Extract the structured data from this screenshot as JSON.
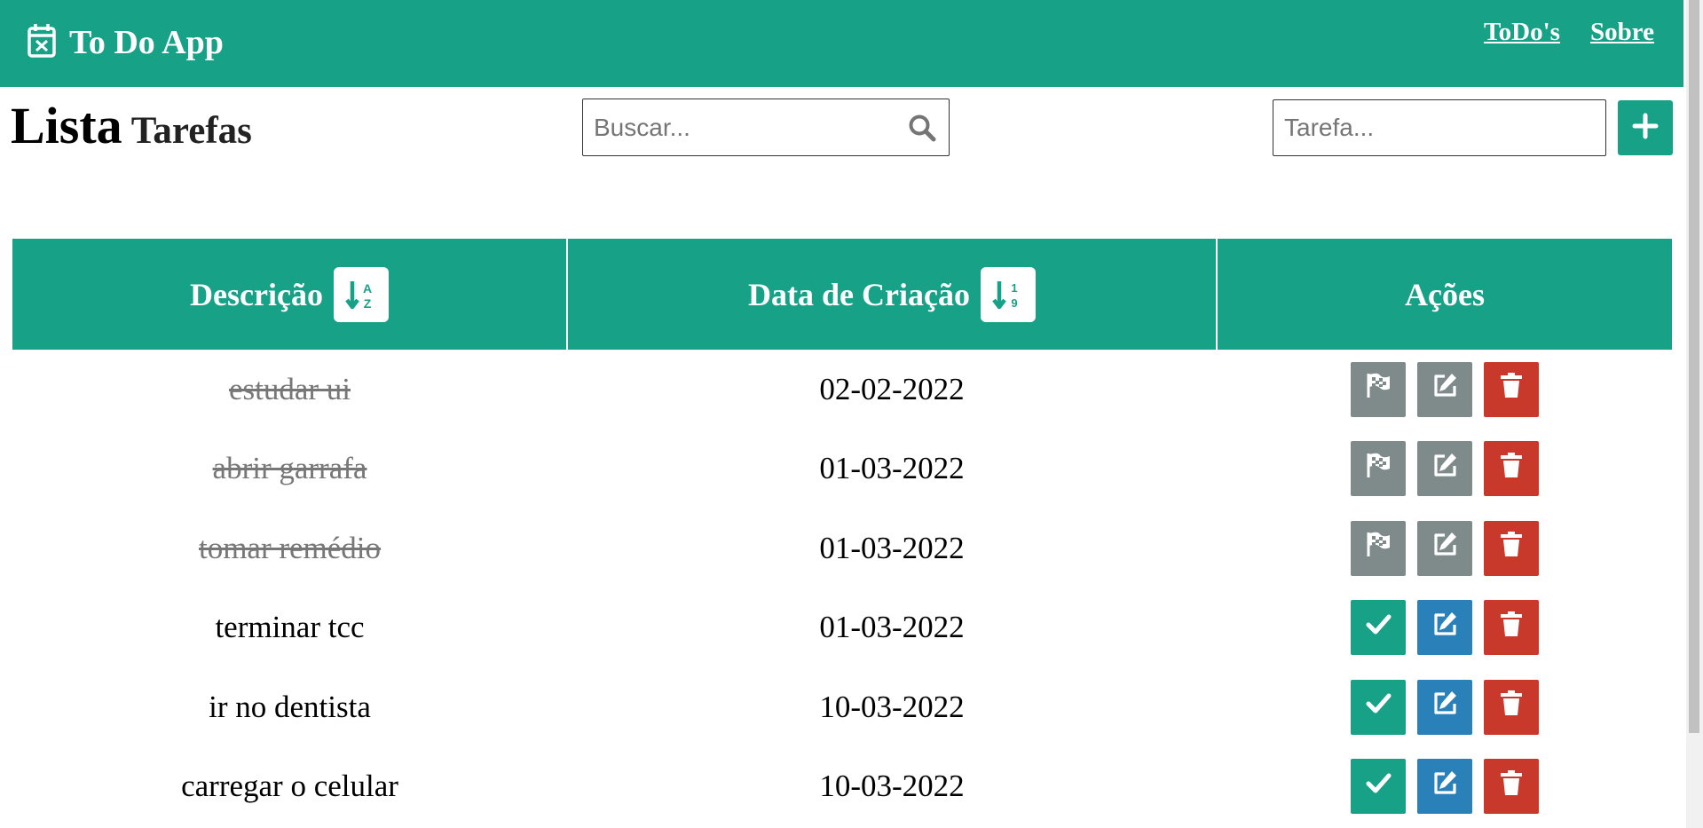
{
  "navbar": {
    "brand_icon": "calendar-x-icon",
    "title": "To Do App",
    "links": [
      "ToDo's",
      "Sobre"
    ]
  },
  "header": {
    "title_big": "Lista",
    "title_small": "Tarefas"
  },
  "search": {
    "placeholder": "Buscar...",
    "value": "",
    "icon": "search-icon"
  },
  "new_task": {
    "placeholder": "Tarefa...",
    "value": "",
    "add_icon": "plus-icon"
  },
  "table": {
    "columns": {
      "description": "Descrição",
      "created": "Data de Criação",
      "actions": "Ações"
    },
    "sort_icons": [
      "sort-alpha-down-icon",
      "sort-numeric-down-icon"
    ],
    "rows": [
      {
        "description": "estudar ui",
        "date": "02-02-2022",
        "done": true
      },
      {
        "description": "abrir garrafa",
        "date": "01-03-2022",
        "done": true
      },
      {
        "description": "tomar remédio",
        "date": "01-03-2022",
        "done": true
      },
      {
        "description": "terminar tcc",
        "date": "01-03-2022",
        "done": false
      },
      {
        "description": "ir no dentista",
        "date": "10-03-2022",
        "done": false
      },
      {
        "description": "carregar o celular",
        "date": "10-03-2022",
        "done": false
      }
    ]
  },
  "colors": {
    "brand": "#17a288",
    "done_gray": "#7f8b8b",
    "edit_blue": "#2a80b9",
    "delete_red": "#c8392c"
  }
}
